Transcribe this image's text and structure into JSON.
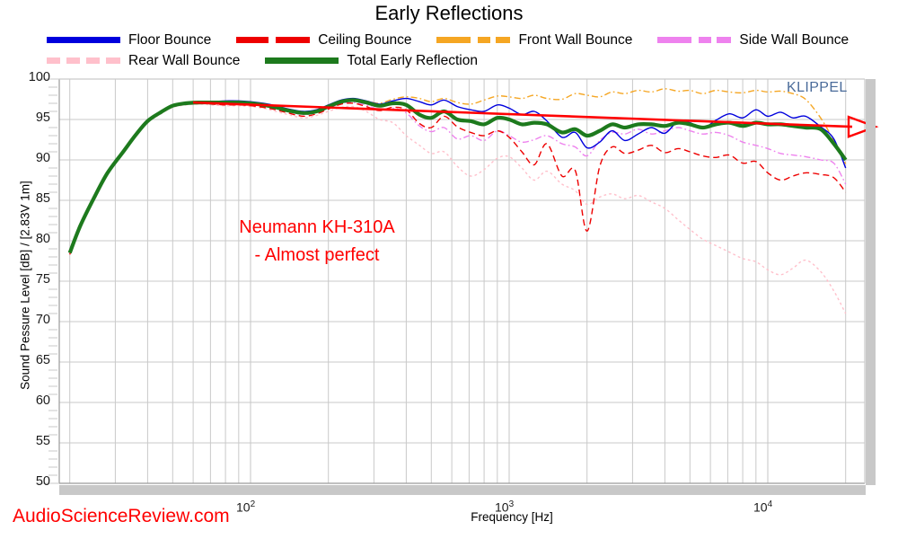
{
  "chart_data": {
    "type": "line",
    "title": "Early Reflections",
    "xlabel": "Frequency [Hz]",
    "ylabel": "Sound Pessure Level [dB] / [2.83V 1m]",
    "xscale": "log",
    "xlim": [
      20,
      20000
    ],
    "ylim": [
      50,
      100
    ],
    "grid": true,
    "legend_position": "top",
    "ytick_labels": [
      "100",
      "95",
      "90",
      "85",
      "80",
      "75",
      "70",
      "65",
      "60",
      "55",
      "50"
    ],
    "ytick_values": [
      100,
      95,
      90,
      85,
      80,
      75,
      70,
      65,
      60,
      55,
      50
    ],
    "xtick_labels": [
      "10 2",
      "10 3",
      "10 4"
    ],
    "xtick_values": [
      100,
      1000,
      10000
    ],
    "annotations": [
      {
        "name": "device-annotation",
        "line1": "Neumann KH-310A",
        "line2": "- Almost perfect",
        "color": "#ff0000"
      },
      {
        "name": "klippel-watermark",
        "text": "KLIPPEL",
        "color": "#4a6b9a"
      },
      {
        "name": "asr-watermark",
        "text": "AudioScienceReview.com",
        "color": "#ff0000"
      },
      {
        "name": "trend-arrow",
        "text": "",
        "color": "#ff0000"
      }
    ],
    "series": [
      {
        "name": "Floor Bounce",
        "color": "#0000dd",
        "style": "solid",
        "width": 1.4,
        "x": [
          20,
          22,
          25,
          28,
          32,
          36,
          40,
          45,
          50,
          56,
          63,
          71,
          80,
          90,
          100,
          112,
          125,
          140,
          160,
          180,
          200,
          224,
          250,
          280,
          315,
          355,
          400,
          450,
          500,
          560,
          630,
          710,
          800,
          900,
          1000,
          1120,
          1250,
          1400,
          1600,
          1800,
          2000,
          2240,
          2500,
          2800,
          3150,
          3550,
          4000,
          4500,
          5000,
          5600,
          6300,
          7100,
          8000,
          9000,
          10000,
          11200,
          12500,
          14000,
          16000,
          18000,
          20000
        ],
        "y": [
          78.6,
          82.0,
          85.6,
          88.5,
          91.0,
          93.2,
          94.9,
          96.0,
          96.8,
          97.1,
          97.2,
          97.2,
          97.3,
          97.3,
          97.2,
          97.0,
          96.7,
          96.3,
          96.0,
          96.2,
          96.8,
          97.4,
          97.6,
          97.3,
          96.9,
          97.3,
          97.6,
          97.2,
          96.8,
          97.4,
          96.6,
          96.2,
          96.0,
          96.8,
          96.4,
          95.6,
          96.0,
          94.8,
          92.8,
          93.4,
          91.5,
          92.2,
          93.6,
          92.4,
          93.2,
          94.0,
          93.3,
          94.8,
          94.6,
          93.9,
          94.9,
          95.7,
          95.2,
          96.2,
          95.4,
          95.9,
          95.2,
          95.4,
          94.1,
          92.6,
          89.0
        ]
      },
      {
        "name": "Ceiling Bounce",
        "color": "#ee0000",
        "style": "dashed",
        "width": 1.4,
        "x": [
          20,
          22,
          25,
          28,
          32,
          36,
          40,
          45,
          50,
          56,
          63,
          71,
          80,
          90,
          100,
          112,
          125,
          140,
          160,
          180,
          200,
          224,
          250,
          280,
          315,
          355,
          400,
          450,
          500,
          560,
          630,
          710,
          800,
          900,
          1000,
          1120,
          1250,
          1400,
          1600,
          1800,
          2000,
          2240,
          2500,
          2800,
          3150,
          3550,
          4000,
          4500,
          5000,
          5600,
          6300,
          7100,
          8000,
          9000,
          10000,
          11200,
          12500,
          14000,
          16000,
          18000,
          20000
        ],
        "y": [
          78.3,
          81.8,
          85.4,
          88.3,
          90.8,
          93.0,
          94.7,
          95.8,
          96.6,
          96.9,
          97.0,
          96.9,
          96.8,
          96.8,
          96.7,
          96.5,
          96.2,
          95.8,
          95.4,
          95.7,
          96.3,
          96.9,
          97.0,
          96.6,
          96.1,
          96.5,
          96.2,
          94.5,
          94.0,
          95.4,
          94.1,
          93.4,
          93.0,
          93.6,
          92.8,
          91.0,
          89.4,
          92.0,
          88.0,
          88.7,
          81.2,
          89.2,
          91.6,
          90.8,
          91.2,
          91.8,
          90.9,
          91.4,
          91.0,
          90.5,
          90.3,
          90.6,
          89.6,
          89.8,
          88.4,
          87.5,
          88.0,
          88.4,
          88.2,
          87.8,
          86.0
        ]
      },
      {
        "name": "Front Wall Bounce",
        "color": "#f5a623",
        "style": "dashdot",
        "width": 1.4,
        "x": [
          20,
          22,
          25,
          28,
          32,
          36,
          40,
          45,
          50,
          56,
          63,
          71,
          80,
          90,
          100,
          112,
          125,
          140,
          160,
          180,
          200,
          224,
          250,
          280,
          315,
          355,
          400,
          450,
          500,
          560,
          630,
          710,
          800,
          900,
          1000,
          1120,
          1250,
          1400,
          1600,
          1800,
          2000,
          2240,
          2500,
          2800,
          3150,
          3550,
          4000,
          4500,
          5000,
          5600,
          6300,
          7100,
          8000,
          9000,
          10000,
          11200,
          12500,
          14000,
          16000,
          18000,
          20000
        ],
        "y": [
          78.5,
          81.9,
          85.5,
          88.4,
          90.9,
          93.1,
          94.8,
          95.9,
          96.7,
          97.0,
          97.1,
          97.1,
          97.2,
          97.2,
          97.1,
          96.9,
          96.6,
          96.2,
          95.9,
          96.1,
          96.7,
          97.3,
          97.5,
          97.3,
          97.0,
          97.5,
          97.8,
          97.6,
          97.2,
          97.6,
          97.1,
          96.9,
          97.4,
          97.9,
          97.8,
          97.6,
          98.0,
          97.6,
          97.5,
          98.2,
          98.0,
          97.8,
          98.4,
          98.2,
          98.6,
          98.4,
          98.8,
          98.5,
          98.6,
          98.2,
          98.6,
          98.4,
          98.3,
          98.6,
          98.4,
          98.5,
          98.2,
          97.5,
          95.2,
          92.4,
          89.5
        ]
      },
      {
        "name": "Side Wall Bounce",
        "color": "#ee82ee",
        "style": "dashdot",
        "width": 1.4,
        "x": [
          20,
          22,
          25,
          28,
          32,
          36,
          40,
          45,
          50,
          56,
          63,
          71,
          80,
          90,
          100,
          112,
          125,
          140,
          160,
          180,
          200,
          224,
          250,
          280,
          315,
          355,
          400,
          450,
          500,
          560,
          630,
          710,
          800,
          900,
          1000,
          1120,
          1250,
          1400,
          1600,
          1800,
          2000,
          2240,
          2500,
          2800,
          3150,
          3550,
          4000,
          4500,
          5000,
          5600,
          6300,
          7100,
          8000,
          9000,
          10000,
          11200,
          12500,
          14000,
          16000,
          18000,
          20000
        ],
        "y": [
          78.4,
          81.8,
          85.5,
          88.4,
          90.9,
          93.1,
          94.8,
          95.9,
          96.7,
          97.0,
          97.1,
          97.0,
          97.0,
          97.0,
          96.9,
          96.7,
          96.4,
          96.0,
          95.6,
          95.9,
          96.4,
          97.0,
          97.1,
          96.8,
          96.2,
          96.4,
          95.8,
          94.2,
          93.5,
          94.0,
          92.6,
          93.0,
          92.4,
          93.6,
          93.0,
          92.2,
          92.5,
          93.0,
          92.0,
          91.6,
          90.5,
          92.4,
          93.4,
          93.2,
          93.8,
          93.2,
          93.6,
          94.0,
          93.6,
          93.2,
          93.4,
          93.0,
          92.2,
          91.8,
          91.4,
          90.8,
          90.6,
          90.4,
          90.0,
          89.6,
          87.0
        ]
      },
      {
        "name": "Rear Wall Bounce",
        "color": "#ffc0cb",
        "style": "dotted",
        "width": 1.4,
        "x": [
          20,
          22,
          25,
          28,
          32,
          36,
          40,
          45,
          50,
          56,
          63,
          71,
          80,
          90,
          100,
          112,
          125,
          140,
          160,
          180,
          200,
          224,
          250,
          280,
          315,
          355,
          400,
          450,
          500,
          560,
          630,
          710,
          800,
          900,
          1000,
          1120,
          1250,
          1400,
          1600,
          1800,
          2000,
          2240,
          2500,
          2800,
          3150,
          3550,
          4000,
          4500,
          5000,
          5600,
          6300,
          7100,
          8000,
          9000,
          10000,
          11200,
          12500,
          14000,
          16000,
          18000,
          20000
        ],
        "y": [
          78.3,
          81.7,
          85.3,
          88.2,
          90.7,
          92.9,
          94.6,
          95.7,
          96.5,
          96.8,
          96.9,
          96.8,
          96.7,
          96.7,
          96.6,
          96.4,
          96.0,
          95.6,
          95.2,
          95.5,
          96.0,
          96.5,
          96.6,
          96.0,
          95.0,
          94.6,
          93.0,
          91.8,
          90.8,
          91.0,
          89.2,
          88.0,
          88.8,
          90.2,
          90.4,
          89.0,
          87.5,
          88.6,
          87.0,
          86.2,
          84.5,
          85.4,
          85.8,
          85.2,
          85.6,
          84.8,
          84.0,
          82.6,
          81.4,
          80.2,
          79.4,
          78.6,
          77.8,
          77.4,
          76.4,
          75.8,
          76.6,
          77.6,
          76.2,
          73.8,
          71.0
        ]
      },
      {
        "name": "Total Early Reflection",
        "color": "#1d7a1d",
        "style": "solid",
        "width": 4.2,
        "x": [
          20,
          22,
          25,
          28,
          32,
          36,
          40,
          45,
          50,
          56,
          63,
          71,
          80,
          90,
          100,
          112,
          125,
          140,
          160,
          180,
          200,
          224,
          250,
          280,
          315,
          355,
          400,
          450,
          500,
          560,
          630,
          710,
          800,
          900,
          1000,
          1120,
          1250,
          1400,
          1600,
          1800,
          2000,
          2240,
          2500,
          2800,
          3150,
          3550,
          4000,
          4500,
          5000,
          5600,
          6300,
          7100,
          8000,
          9000,
          10000,
          11200,
          12500,
          14000,
          16000,
          18000,
          20000
        ],
        "y": [
          78.5,
          81.9,
          85.5,
          88.4,
          90.9,
          93.1,
          94.8,
          95.9,
          96.7,
          97.0,
          97.1,
          97.1,
          97.1,
          97.1,
          97.0,
          96.8,
          96.5,
          96.1,
          95.8,
          96.0,
          96.6,
          97.2,
          97.4,
          97.1,
          96.7,
          97.0,
          96.8,
          95.6,
          95.2,
          96.0,
          95.0,
          94.8,
          94.4,
          95.2,
          95.0,
          94.4,
          94.6,
          94.4,
          93.4,
          93.8,
          93.0,
          93.6,
          94.4,
          94.0,
          94.4,
          94.4,
          94.2,
          94.6,
          94.4,
          94.0,
          94.4,
          94.6,
          94.2,
          94.6,
          94.4,
          94.4,
          94.2,
          94.0,
          93.8,
          92.0,
          90.0
        ]
      }
    ],
    "trend_line": {
      "name": "on-axis trend",
      "color": "#ff0000",
      "width": 2.6,
      "x1": 60,
      "y1": 97.1,
      "x2": 20000,
      "y2": 94.1,
      "arrow": true
    }
  },
  "legend": {
    "rows": [
      [
        {
          "label": "Floor Bounce",
          "color": "#0000dd",
          "style": "solid"
        },
        {
          "label": "Ceiling Bounce",
          "color": "#ee0000",
          "style": "dashed"
        },
        {
          "label": "Front Wall Bounce",
          "color": "#f5a623",
          "style": "dashdot"
        },
        {
          "label": "Side Wall Bounce",
          "color": "#ee82ee",
          "style": "dashdot"
        }
      ],
      [
        {
          "label": "Rear Wall Bounce",
          "color": "#ffc0cb",
          "style": "dotted"
        },
        {
          "label": "Total Early Reflection",
          "color": "#1d7a1d",
          "style": "solid"
        }
      ]
    ]
  },
  "colors": {
    "grid": "#c9c9c9",
    "axis": "#9a9a9a",
    "background": "#ffffff",
    "annotation_red": "#ff0000",
    "klippel": "#4a6b9a",
    "scrollbar": "#c8c8c8"
  }
}
